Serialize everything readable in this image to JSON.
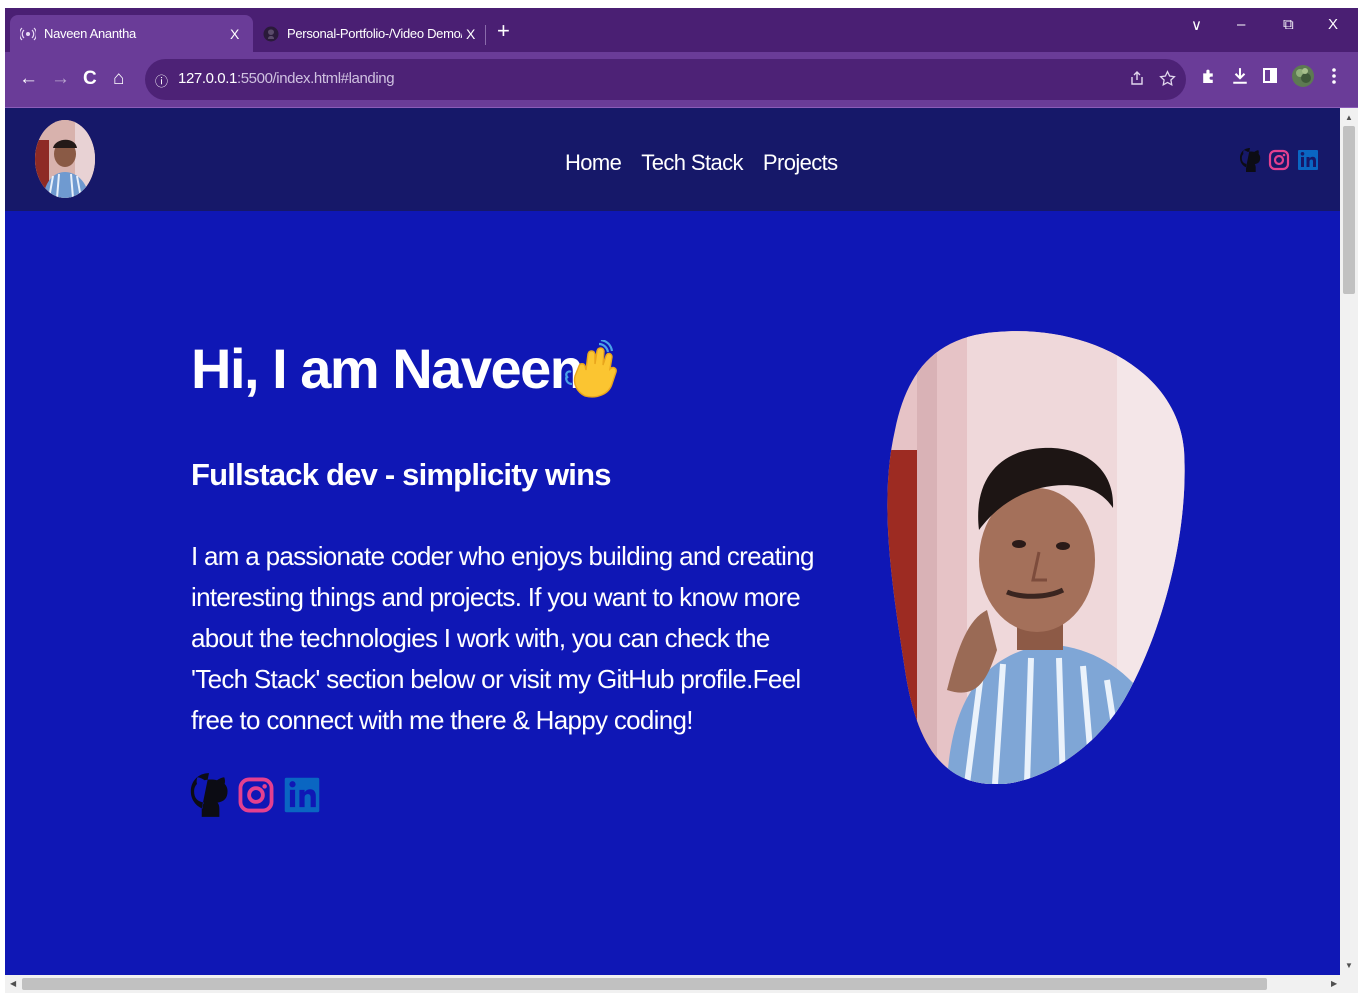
{
  "browser": {
    "tabs": [
      {
        "title": "Naveen Anantha",
        "favicon": "broadcast-icon",
        "close": "X",
        "active": true
      },
      {
        "title": "Personal-Portfolio-/Video Demo/",
        "favicon": "github-icon",
        "close": "X",
        "active": false
      }
    ],
    "new_tab": "+",
    "window_controls": {
      "tab_search": "∨",
      "minimize": "–",
      "restore": "⧉",
      "close": "X"
    },
    "nav": {
      "back": "←",
      "forward": "→",
      "reload": "C",
      "home": "⌂"
    },
    "address": {
      "host": "127.0.0.1",
      "path": ":5500/index.html#landing",
      "info_icon": "ⓘ"
    },
    "toolbar_icons": [
      "share-icon",
      "star-icon",
      "puzzle-icon",
      "download-icon",
      "sidebar-icon",
      "profile-icon",
      "menu-icon"
    ]
  },
  "site": {
    "nav_links": [
      "Home",
      "Tech Stack",
      "Projects"
    ],
    "social_icons": [
      "github-icon",
      "instagram-icon",
      "linkedin-icon"
    ]
  },
  "hero": {
    "title": "Hi, I am Naveen",
    "subtitle": "Fullstack dev - simplicity wins",
    "description": "I am a passionate coder who enjoys building and creating interesting things and projects. If you want to know more about the technologies I work with, you can check the 'Tech Stack' section below or visit my GitHub profile.Feel free to connect with me there & Happy coding!",
    "wave_icon": "waving-hand-icon"
  },
  "colors": {
    "tab_strip": "#4a1f73",
    "toolbar": "#6a3c98",
    "site_nav": "#161869",
    "page_bg": "#0f17b5",
    "instagram": "#e4408f",
    "linkedin": "#0a66c2"
  }
}
